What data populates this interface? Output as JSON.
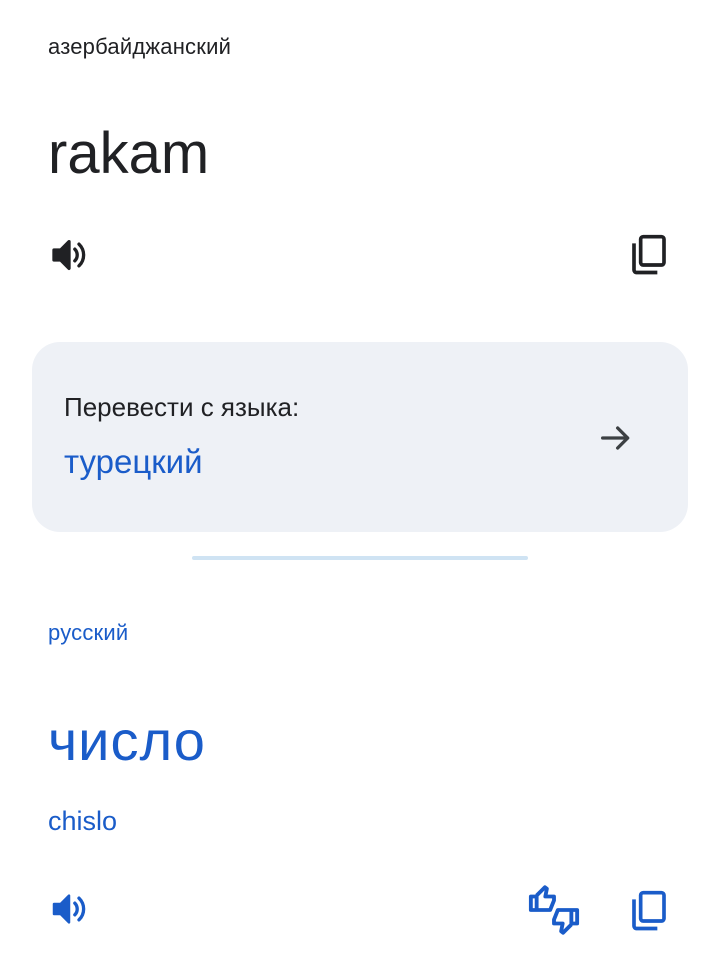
{
  "source": {
    "language": "азербайджанский",
    "text": "rakam",
    "speak_icon": "volume-icon",
    "copy_icon": "copy-icon"
  },
  "detect_card": {
    "label": "Перевести с языка:",
    "language": "турецкий",
    "arrow_icon": "arrow-right-icon"
  },
  "target": {
    "language": "русский",
    "text": "число",
    "transliteration": "chislo",
    "speak_icon": "volume-icon",
    "rate_icon": "thumbs-up-down-icon",
    "copy_icon": "copy-icon"
  },
  "colors": {
    "accent": "#1a5cc9",
    "text": "#202124",
    "card_bg": "#eef1f6",
    "divider": "#cfe3f3"
  }
}
